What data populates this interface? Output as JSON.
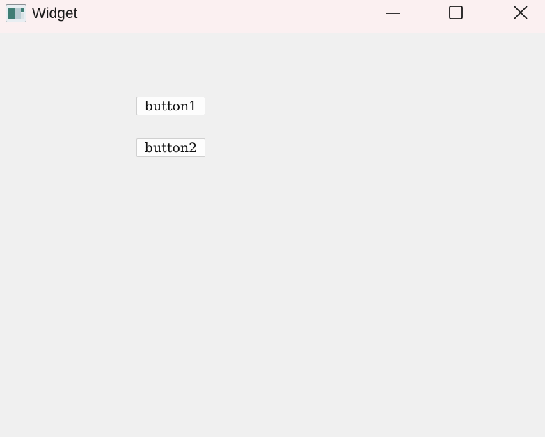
{
  "window": {
    "title": "Widget",
    "controls": {
      "minimize_icon": "minimize-icon",
      "maximize_icon": "maximize-icon",
      "close_icon": "close-icon"
    }
  },
  "content": {
    "buttons": [
      {
        "label": "button1"
      },
      {
        "label": "button2"
      }
    ]
  },
  "colors": {
    "titlebar_bg": "#fbf0f1",
    "client_bg": "#f0f0f0"
  }
}
